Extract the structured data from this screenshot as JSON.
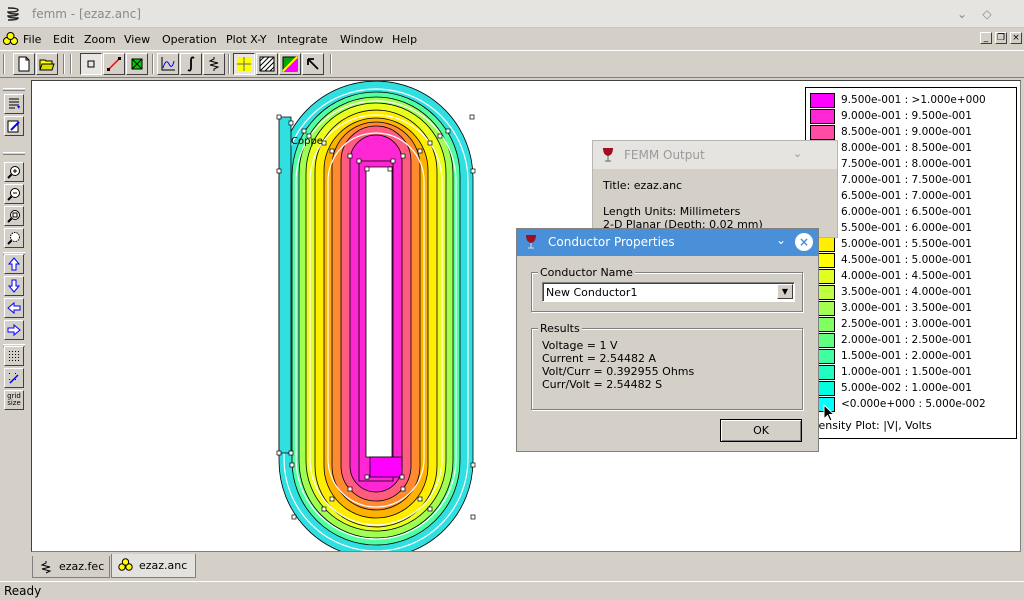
{
  "window": {
    "title": "femm - [ezaz.anc]"
  },
  "menu": {
    "items": [
      "File",
      "Edit",
      "Zoom",
      "View",
      "Operation",
      "Plot X-Y",
      "Integrate",
      "Window",
      "Help"
    ]
  },
  "canvas": {
    "region_label": "Coppe"
  },
  "legend": {
    "rows": [
      {
        "label": "9.500e-001 : >1.000e+000",
        "color": "#ff00ff"
      },
      {
        "label": "9.000e-001 : 9.500e-001",
        "color": "#ff26d4"
      },
      {
        "label": "8.500e-001 : 9.000e-001",
        "color": "#ff4da6"
      },
      {
        "label": "8.000e-001 : 8.500e-001",
        "color": "#ff5c80"
      },
      {
        "label": "7.500e-001 : 8.000e-001",
        "color": "#ff7060"
      },
      {
        "label": "7.000e-001 : 7.500e-001",
        "color": "#ff8040"
      },
      {
        "label": "6.500e-001 : 7.000e-001",
        "color": "#ff9920"
      },
      {
        "label": "6.000e-001 : 6.500e-001",
        "color": "#ffb300"
      },
      {
        "label": "5.500e-001 : 6.000e-001",
        "color": "#ffd100"
      },
      {
        "label": "5.000e-001 : 5.500e-001",
        "color": "#ffee00"
      },
      {
        "label": "4.500e-001 : 5.000e-001",
        "color": "#ffff00"
      },
      {
        "label": "4.000e-001 : 4.500e-001",
        "color": "#e0ff20"
      },
      {
        "label": "3.500e-001 : 4.000e-001",
        "color": "#c0ff40"
      },
      {
        "label": "3.000e-001 : 3.500e-001",
        "color": "#a0ff50"
      },
      {
        "label": "2.500e-001 : 3.000e-001",
        "color": "#80ff60"
      },
      {
        "label": "2.000e-001 : 2.500e-001",
        "color": "#60ff80"
      },
      {
        "label": "1.500e-001 : 2.000e-001",
        "color": "#40ffa0"
      },
      {
        "label": "1.000e-001 : 1.500e-001",
        "color": "#20ffc0"
      },
      {
        "label": "5.000e-002 : 1.000e-001",
        "color": "#00ffe0"
      },
      {
        "label": "<0.000e+000 : 5.000e-002",
        "color": "#00ffff"
      }
    ],
    "caption": "Density Plot: |V|, Volts"
  },
  "output_window": {
    "title": "FEMM Output",
    "lines": [
      "Title: ezaz.anc",
      "Length Units: Millimeters",
      "2-D Planar (Depth: 0.02 mm)"
    ]
  },
  "conductor_dialog": {
    "title": "Conductor Properties",
    "name_group_label": "Conductor Name",
    "selected_conductor": "New Conductor1",
    "results_group_label": "Results",
    "results": [
      "Voltage = 1 V",
      "Current = 2.54482 A",
      "Volt/Curr = 0.392955 Ohms",
      "Curr/Volt = 2.54482 S"
    ],
    "ok_label": "OK"
  },
  "grid_size_label": "grid size",
  "tabs": [
    {
      "label": "ezaz.fec",
      "active": false
    },
    {
      "label": "ezaz.anc",
      "active": true
    }
  ],
  "status": {
    "text": "Ready"
  },
  "colors": {
    "dialog_title": "#4a90d9",
    "cyan": "#00ffff",
    "outer_cyan": "#30e0e0"
  }
}
